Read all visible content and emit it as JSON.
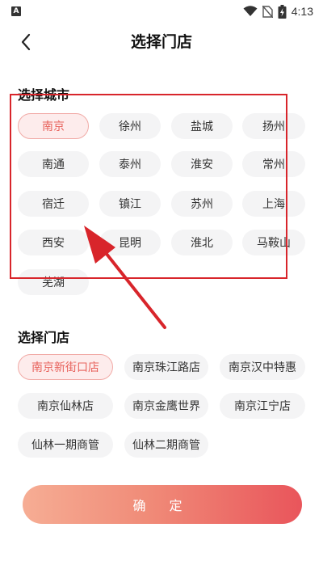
{
  "status_bar": {
    "left_icon_label": "A",
    "time": "4:13",
    "icons": [
      "wifi-icon",
      "no-sim-icon",
      "battery-charging-icon"
    ]
  },
  "nav": {
    "back_icon": "chevron-left-icon",
    "title": "选择门店"
  },
  "city_section": {
    "title": "选择城市",
    "selected": "南京",
    "cities": [
      "南京",
      "徐州",
      "盐城",
      "扬州",
      "南通",
      "泰州",
      "淮安",
      "常州",
      "宿迁",
      "镇江",
      "苏州",
      "上海",
      "西安",
      "昆明",
      "淮北",
      "马鞍山",
      "芜湖"
    ]
  },
  "store_section": {
    "title": "选择门店",
    "selected": "南京新街口店",
    "stores": [
      "南京新街口店",
      "南京珠江路店",
      "南京汉中特惠",
      "南京仙林店",
      "南京金鹰世界",
      "南京江宁店",
      "仙林一期商管",
      "仙林二期商管"
    ]
  },
  "confirm_label": "确 定",
  "colors": {
    "accent": "#e8625c",
    "selected_bg": "#fdecec",
    "chip_bg": "#f4f4f5",
    "annotation": "#d8252b",
    "button_gradient": [
      "#f6ad94",
      "#e9555b"
    ]
  }
}
